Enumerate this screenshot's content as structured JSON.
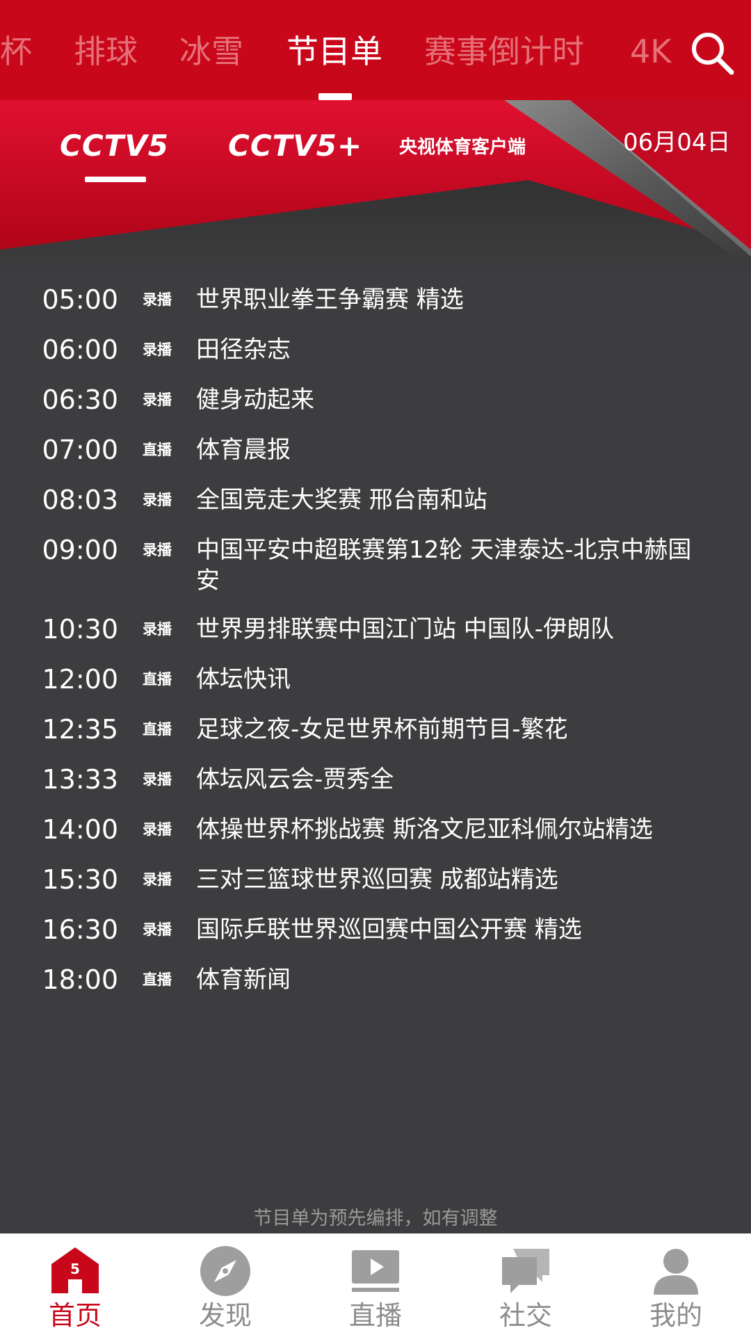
{
  "colors": {
    "brand_red": "#c8071a",
    "list_background": "#3d3d3f",
    "nav_inactive": "#8c8c8c"
  },
  "category_tabs": [
    {
      "label": "杯",
      "active": false
    },
    {
      "label": "排球",
      "active": false
    },
    {
      "label": "冰雪",
      "active": false
    },
    {
      "label": "节目单",
      "active": true
    },
    {
      "label": "赛事倒计时",
      "active": false
    },
    {
      "label": "4K",
      "active": false
    }
  ],
  "search_icon": "search-icon",
  "channels": [
    {
      "label": "CCTV5",
      "active": true
    },
    {
      "label": "CCTV5+",
      "active": false
    }
  ],
  "client_name": "央视体育客户端",
  "schedule_date": "06月04日",
  "schedule": [
    {
      "time": "05:00",
      "tag": "录播",
      "title": "世界职业拳王争霸赛 精选"
    },
    {
      "time": "06:00",
      "tag": "录播",
      "title": "田径杂志"
    },
    {
      "time": "06:30",
      "tag": "录播",
      "title": "健身动起来"
    },
    {
      "time": "07:00",
      "tag": "直播",
      "title": "体育晨报"
    },
    {
      "time": "08:03",
      "tag": "录播",
      "title": "全国竞走大奖赛 邢台南和站"
    },
    {
      "time": "09:00",
      "tag": "录播",
      "title": "中国平安中超联赛第12轮 天津泰达-北京中赫国安"
    },
    {
      "time": "10:30",
      "tag": "录播",
      "title": "世界男排联赛中国江门站 中国队-伊朗队"
    },
    {
      "time": "12:00",
      "tag": "直播",
      "title": "体坛快讯"
    },
    {
      "time": "12:35",
      "tag": "直播",
      "title": "足球之夜-女足世界杯前期节目-繁花"
    },
    {
      "time": "13:33",
      "tag": "录播",
      "title": "体坛风云会-贾秀全"
    },
    {
      "time": "14:00",
      "tag": "录播",
      "title": "体操世界杯挑战赛 斯洛文尼亚科佩尔站精选"
    },
    {
      "time": "15:30",
      "tag": "录播",
      "title": "三对三篮球世界巡回赛 成都站精选"
    },
    {
      "time": "16:30",
      "tag": "录播",
      "title": "国际乒联世界巡回赛中国公开赛 精选"
    },
    {
      "time": "18:00",
      "tag": "直播",
      "title": "体育新闻"
    }
  ],
  "footer_note": "节目单为预先编排，如有调整",
  "bottom_nav": [
    {
      "label": "首页",
      "icon": "home-icon",
      "active": true
    },
    {
      "label": "发现",
      "icon": "compass-icon",
      "active": false
    },
    {
      "label": "直播",
      "icon": "live-tv-icon",
      "active": false
    },
    {
      "label": "社交",
      "icon": "chat-icon",
      "active": false
    },
    {
      "label": "我的",
      "icon": "user-icon",
      "active": false
    }
  ]
}
